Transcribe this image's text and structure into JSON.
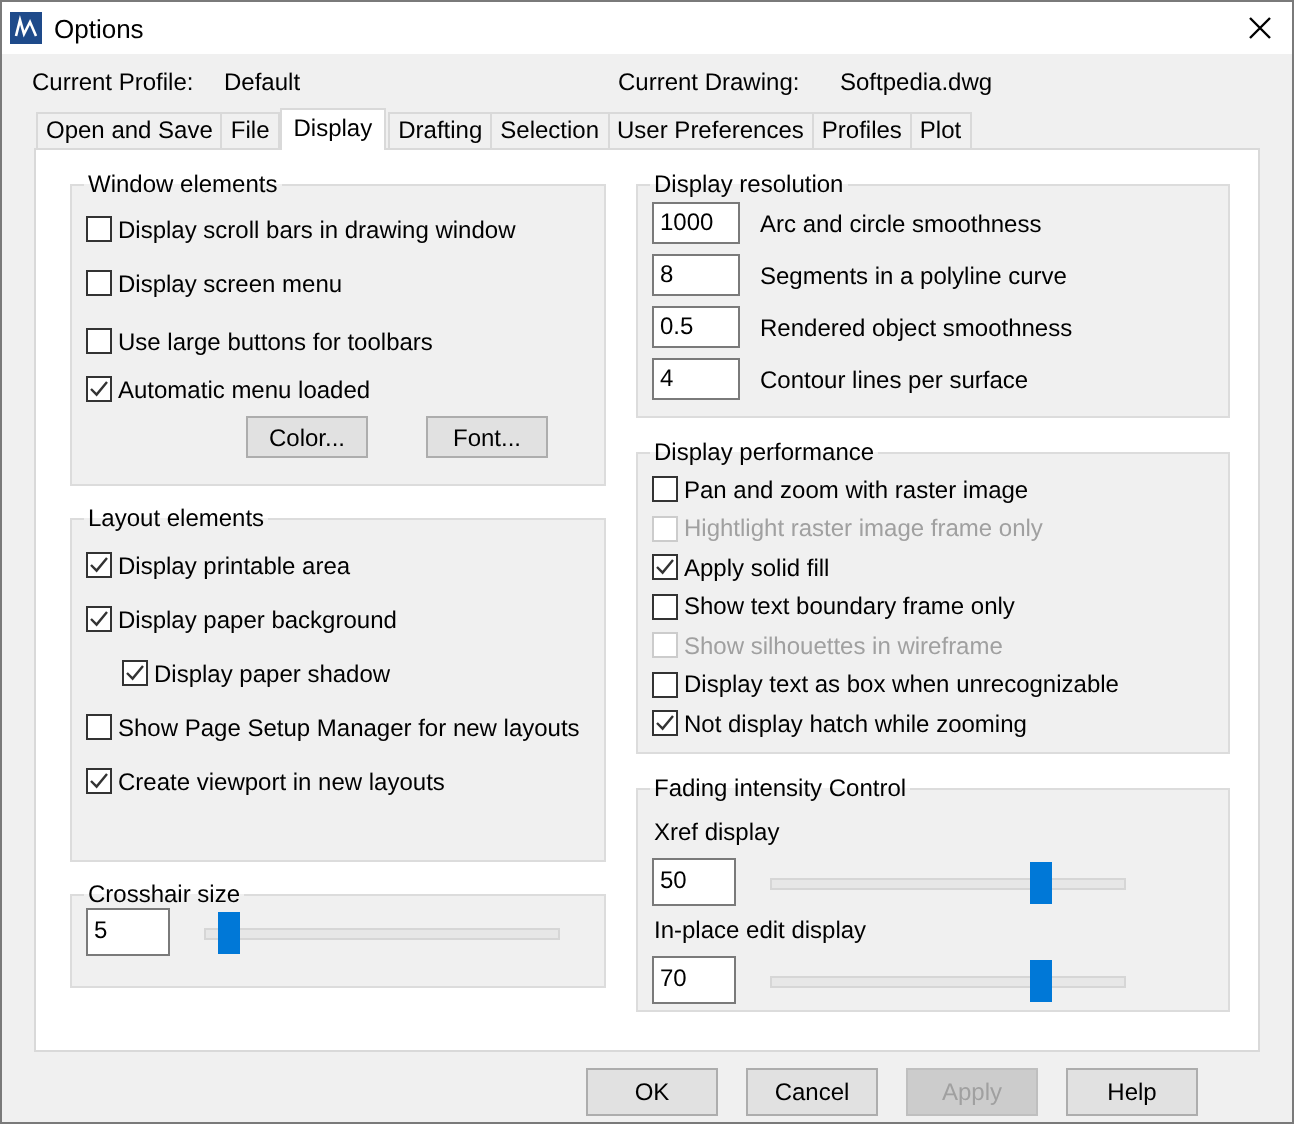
{
  "window": {
    "title": "Options"
  },
  "header": [
    {
      "label": "Current Profile:",
      "value": "Default"
    },
    {
      "label": "Current Drawing:",
      "value": "Softpedia.dwg"
    }
  ],
  "tabs": [
    {
      "label": "Open and Save",
      "selected": false
    },
    {
      "label": "File",
      "selected": false
    },
    {
      "label": "Display",
      "selected": true
    },
    {
      "label": "Drafting",
      "selected": false
    },
    {
      "label": "Selection",
      "selected": false
    },
    {
      "label": "User Preferences",
      "selected": false
    },
    {
      "label": "Profiles",
      "selected": false
    },
    {
      "label": "Plot",
      "selected": false
    }
  ],
  "window_elements": {
    "title": "Window elements",
    "checkboxes": [
      {
        "label": "Display scroll bars in drawing window",
        "checked": false
      },
      {
        "label": "Display screen menu",
        "checked": false
      },
      {
        "label": "Use large buttons for toolbars",
        "checked": false
      },
      {
        "label": "Automatic menu loaded",
        "checked": true
      }
    ],
    "buttons": [
      "Color...",
      "Font..."
    ]
  },
  "layout_elements": {
    "title": "Layout elements",
    "checkboxes": [
      {
        "label": "Display printable area",
        "checked": true
      },
      {
        "label": "Display paper background",
        "checked": true,
        "children": [
          {
            "label": "Display paper shadow",
            "checked": true
          }
        ]
      },
      {
        "label": "Show Page Setup Manager for new layouts",
        "checked": false
      },
      {
        "label": "Create viewport in new layouts",
        "checked": true
      }
    ]
  },
  "crosshair": {
    "title": "Crosshair size",
    "value": "5",
    "level": 0.04
  },
  "display_resolution": {
    "title": "Display resolution",
    "fields": [
      {
        "value": "1000",
        "label": "Arc and circle smoothness"
      },
      {
        "value": "8",
        "label": "Segments in a polyline curve"
      },
      {
        "value": "0.5",
        "label": "Rendered object smoothness"
      },
      {
        "value": "4",
        "label": "Contour lines per surface"
      }
    ]
  },
  "display_performance": {
    "title": "Display performance",
    "checkboxes": [
      {
        "label": "Pan and zoom with raster image",
        "checked": false,
        "disabled": false
      },
      {
        "label": "Hightlight raster image frame only",
        "checked": false,
        "disabled": true
      },
      {
        "label": "Apply solid fill",
        "checked": true,
        "disabled": false
      },
      {
        "label": "Show text boundary frame only",
        "checked": false,
        "disabled": false
      },
      {
        "label": "Show silhouettes in wireframe",
        "checked": false,
        "disabled": true
      },
      {
        "label": "Display text as box when unrecognizable",
        "checked": false,
        "disabled": false
      },
      {
        "label": "Not display hatch while zooming",
        "checked": true,
        "disabled": false
      }
    ]
  },
  "fading": {
    "title": "Fading intensity Control",
    "controls": [
      {
        "label": "Xref display",
        "value": "50",
        "level": 0.78
      },
      {
        "label": "In-place edit display",
        "value": "70",
        "level": 0.78
      }
    ]
  },
  "buttons": [
    {
      "label": "OK",
      "disabled": false
    },
    {
      "label": "Cancel",
      "disabled": false
    },
    {
      "label": "Apply",
      "disabled": true
    },
    {
      "label": "Help",
      "disabled": false
    }
  ]
}
